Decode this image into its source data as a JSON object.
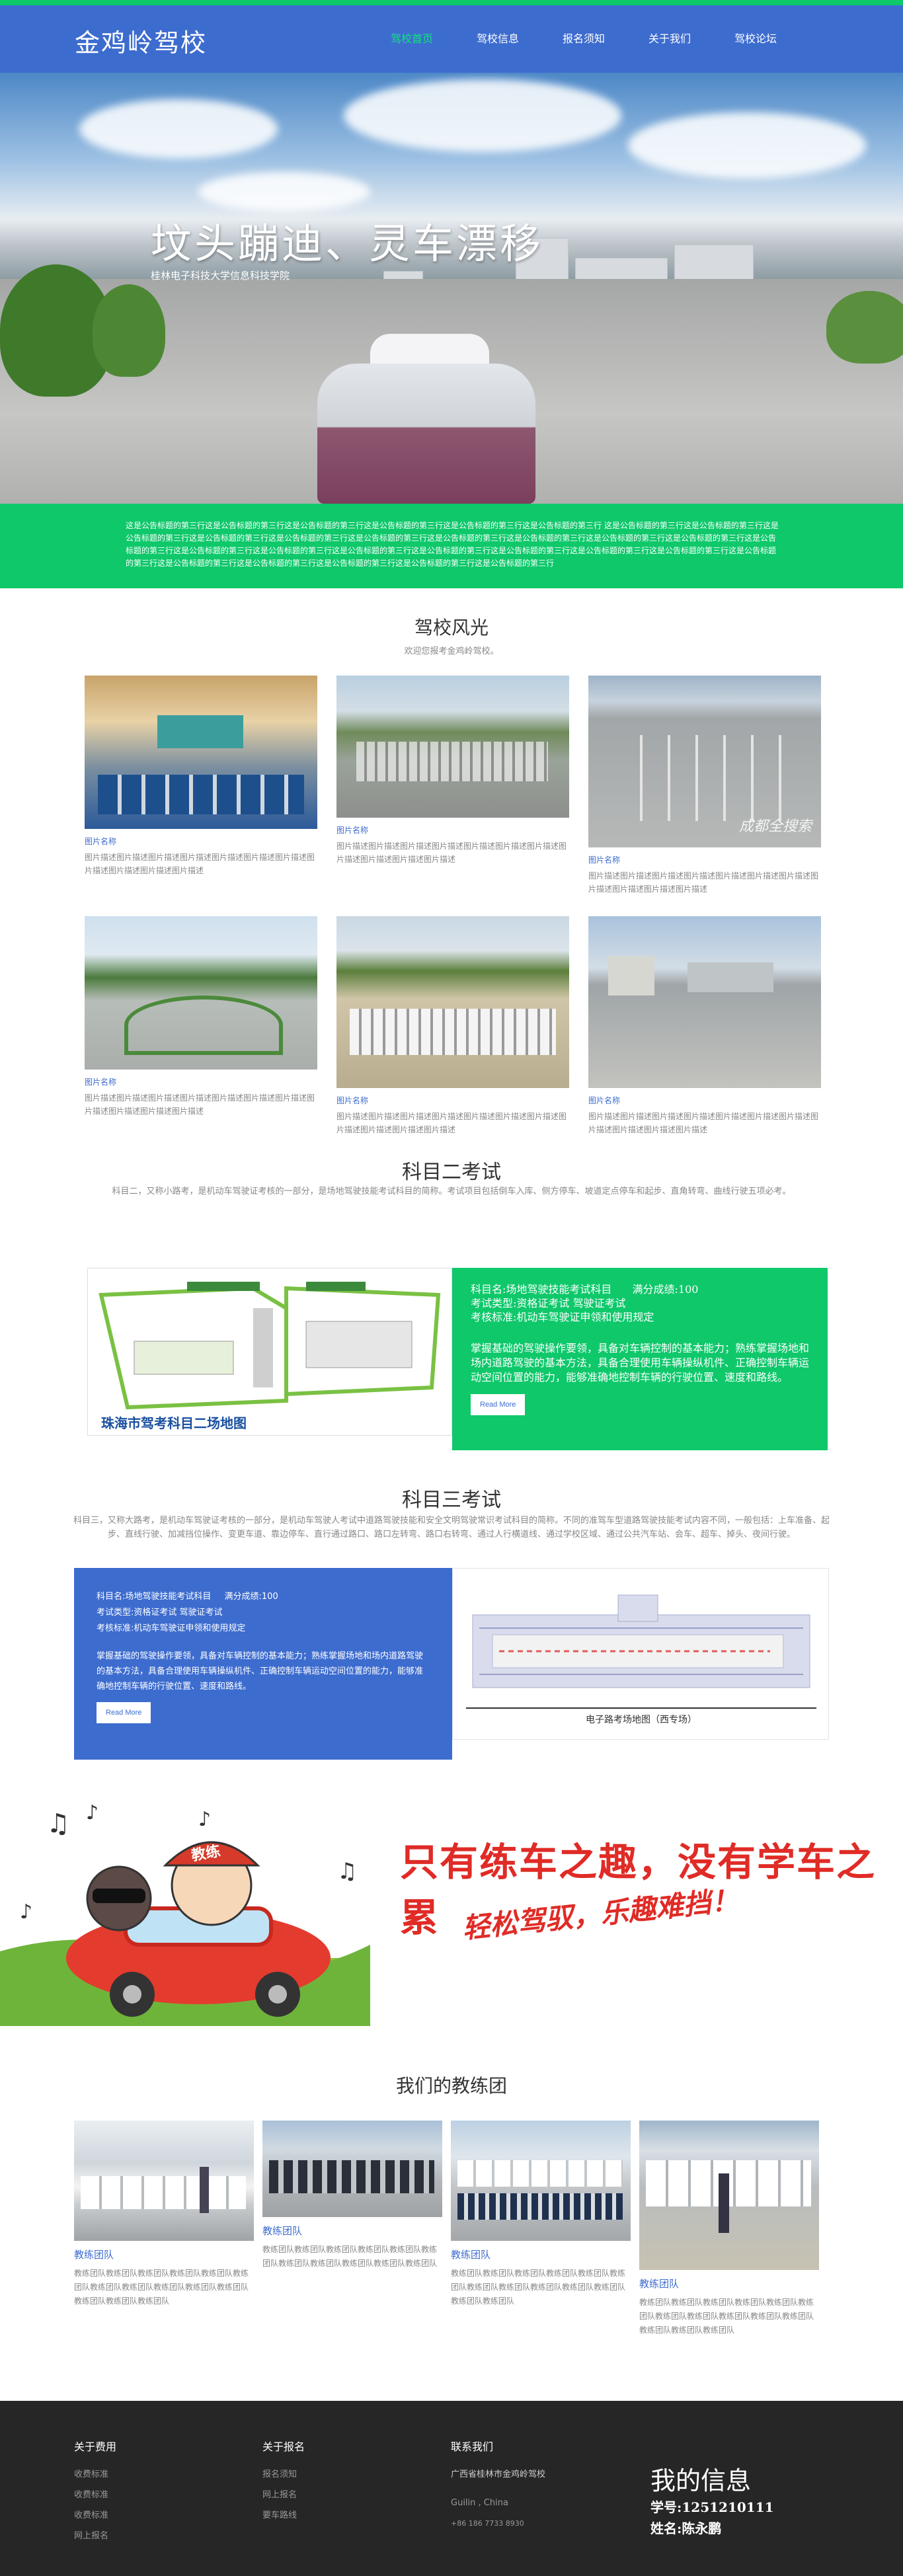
{
  "header": {
    "logo": "金鸡岭驾校",
    "nav": [
      "驾校首页",
      "驾校信息",
      "报名须知",
      "关于我们",
      "驾校论坛"
    ],
    "active_index": 0
  },
  "hero": {
    "title": "坟头蹦迪、灵车漂移",
    "subtitle": "桂林电子科技大学信息科技学院"
  },
  "band": {
    "text": "这是公告标题的第三行这是公告标题的第三行这是公告标题的第三行这是公告标题的第三行这是公告标题的第三行这是公告标题的第三行 这是公告标题的第三行这是公告标题的第三行这是公告标题的第三行这是公告标题的第三行这是公告标题的第三行这是公告标题的第三行这是公告标题的第三行这是公告标题的第三行这是公告标题的第三行这是公告标题的第三行这是公告标题的第三行这是公告标题的第三行这是公告标题的第三行这是公告标题的第三行这是公告标题的第三行这是公告标题的第三行这是公告标题的第三行这是公告标题的第三行这是公告标题的第三行这是公告标题的第三行这是公告标题的第三行这是公告标题的第三行这是公告标题的第三行这是公告标题的第三行"
  },
  "gallery": {
    "title": "驾校风光",
    "subtitle": "欢迎您报考金鸡岭驾校。",
    "items": [
      {
        "name": "图片名称",
        "desc": "图片描述图片描述图片描述图片描述图片描述图片描述图片描述图片描述图片描述图片描述图片描述"
      },
      {
        "name": "图片名称",
        "desc": "图片描述图片描述图片描述图片描述图片描述图片描述图片描述图片描述图片描述图片描述图片描述"
      },
      {
        "name": "图片名称",
        "desc": "图片描述图片描述图片描述图片描述图片描述图片描述图片描述图片描述图片描述图片描述图片描述"
      },
      {
        "name": "图片名称",
        "desc": "图片描述图片描述图片描述图片描述图片描述图片描述图片描述图片描述图片描述图片描述图片描述"
      },
      {
        "name": "图片名称",
        "desc": "图片描述图片描述图片描述图片描述图片描述图片描述图片描述图片描述图片描述图片描述图片描述"
      },
      {
        "name": "图片名称",
        "desc": "图片描述图片描述图片描述图片描述图片描述图片描述图片描述图片描述图片描述图片描述图片描述"
      }
    ],
    "watermark": "成都全搜索"
  },
  "subject2": {
    "title": "科目二考试",
    "desc": "科目二，又称小路考，是机动车驾驶证考核的一部分，是场地驾驶技能考试科目的简称。考试项目包括倒车入库、侧方停车、坡道定点停车和起步、直角转弯、曲线行驶五项必考。",
    "map_caption": "珠海市驾考科目二场地图",
    "line1": "科目名:场地驾驶技能考试科目",
    "score": "满分成绩:100",
    "line2": "考试类型:资格证考试 驾驶证考试",
    "line3": "考核标准:机动车驾驶证申领和使用规定",
    "body": "掌握基础的驾驶操作要领，具备对车辆控制的基本能力；熟练掌握场地和场内道路驾驶的基本方法，具备合理使用车辆操纵机件、正确控制车辆运动空间位置的能力，能够准确地控制车辆的行驶位置、速度和路线。",
    "button": "Read More"
  },
  "subject3": {
    "title": "科目三考试",
    "desc": "科目三，又称大路考，是机动车驾驶证考核的一部分，是机动车驾驶人考试中道路驾驶技能和安全文明驾驶常识考试科目的简称。不同的准驾车型道路驾驶技能考试内容不同，一般包括：上车准备、起步、直线行驶、加减挡位操作、变更车道、靠边停车、直行通过路口、路口左转弯、路口右转弯、通过人行横道线、通过学校区域、通过公共汽车站、会车、超车、掉头、夜间行驶。",
    "line1": "科目名:场地驾驶技能考试科目",
    "score": "满分成绩:100",
    "line2": "考试类型:资格证考试 驾驶证考试",
    "line3": "考核标准:机动车驾驶证申领和使用规定",
    "body": "掌握基础的驾驶操作要领，具备对车辆控制的基本能力；熟练掌握场地和场内道路驾驶的基本方法，具备合理使用车辆操纵机件、正确控制车辆运动空间位置的能力，能够准确地控制车辆的行驶位置、速度和路线。",
    "button": "Read More",
    "map_caption": "电子路考场地图（西专场）"
  },
  "banner": {
    "line1": "只有练车之趣，没有学车之累",
    "line2": "轻松驾驭，乐趣难挡！",
    "hat_text": "教练"
  },
  "coaches": {
    "title": "我们的教练团",
    "items": [
      {
        "name": "教练团队",
        "desc": "教练团队教练团队教练团队教练团队教练团队教练团队教练团队教练团队教练团队教练团队教练团队教练团队教练团队教练团队"
      },
      {
        "name": "教练团队",
        "desc": "教练团队教练团队教练团队教练团队教练团队教练团队教练团队教练团队教练团队教练团队教练团队"
      },
      {
        "name": "教练团队",
        "desc": "教练团队教练团队教练团队教练团队教练团队教练团队教练团队教练团队教练团队教练团队教练团队教练团队教练团队"
      },
      {
        "name": "教练团队",
        "desc": "教练团队教练团队教练团队教练团队教练团队教练团队教练团队教练团队教练团队教练团队教练团队教练团队教练团队教练团队"
      }
    ]
  },
  "footer": {
    "col1": {
      "title": "关于费用",
      "links": [
        "收费标准",
        "收费标准",
        "收费标准",
        "网上报名"
      ]
    },
    "col2": {
      "title": "关于报名",
      "links": [
        "报名须知",
        "网上报名",
        "要车路线"
      ]
    },
    "col3": {
      "title": "联系我们",
      "lines": [
        "广西省桂林市金鸡岭驾校",
        "Guilin , China",
        "+86 186 7733 8930"
      ]
    },
    "myinfo": {
      "title": "我的信息",
      "id": "学号:1251210111",
      "name": "姓名:陈永鹏"
    }
  },
  "colors": {
    "brand_blue": "#3d6ccf",
    "brand_green": "#0ec86a"
  }
}
